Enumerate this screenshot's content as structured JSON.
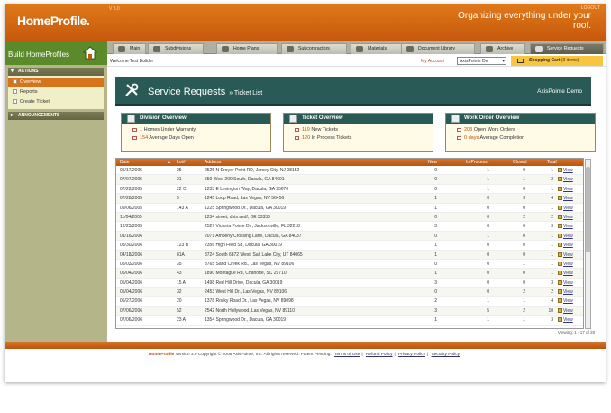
{
  "app": {
    "logo": "HomeProfile.",
    "version": "V 3.0",
    "tagline": "Organizing everything under your roof.",
    "logout": "LOGOUT"
  },
  "sidebar": {
    "title": "Build HomeProfiles",
    "actions": "ACTIONS",
    "items": [
      {
        "label": "Overview"
      },
      {
        "label": "Reports"
      },
      {
        "label": "Create Ticket"
      }
    ],
    "announcements": "ANNOUNCEMENTS"
  },
  "tabs": [
    {
      "label": "Main"
    },
    {
      "label": "Subdivisions"
    },
    {
      "label": "Home Plans"
    },
    {
      "label": "Subcontractors"
    },
    {
      "label": "Materials"
    },
    {
      "label": "Document Library"
    },
    {
      "label": "Archive"
    },
    {
      "label": "Service Requests"
    }
  ],
  "userbar": {
    "welcome": "Welcome Test Builder",
    "my_account": "My Account",
    "account_select": "AxisPointe De",
    "cart": "Shopping Cart",
    "cart_count": "(3 items)"
  },
  "banner": {
    "title": "Service Requests",
    "sub": "» Ticket List",
    "company": "AxisPointe Demo"
  },
  "division": {
    "title": "Division Overview",
    "l1n": "1",
    "l1": "Homes Under Warranty",
    "l2n": "154",
    "l2": "Average Days Open"
  },
  "ticket": {
    "title": "Ticket Overview",
    "l1n": "119",
    "l1": "New Tickets",
    "l2n": "120",
    "l2": "In Process Tickets"
  },
  "workorder": {
    "title": "Work Order Overview",
    "l1n": "203",
    "l1": "Open Work Orders",
    "l2n": "0 days",
    "l2": "Average Completion"
  },
  "table": {
    "headers": [
      "Date",
      "▲",
      "Lot#",
      "Address",
      "New",
      "In Process",
      "Closed",
      "Total"
    ],
    "view_label": "View",
    "rows": [
      [
        "05/17/2005",
        "25",
        "2525 N Droyer Point RD, Jersey City, NJ 08152",
        "0",
        "1",
        "0",
        "1"
      ],
      [
        "07/07/2005",
        "21",
        "550 West 200 South, Dacula, GA 84601",
        "0",
        "1",
        "1",
        "2"
      ],
      [
        "07/22/2005",
        "22 C",
        "1233 E Lexington Way, Dacula, GA 95670",
        "0",
        "1",
        "0",
        "1"
      ],
      [
        "07/28/2005",
        "5",
        "1245 Loop Road, Las Vegas, NV 56456",
        "1",
        "0",
        "3",
        "4"
      ],
      [
        "09/06/2005",
        "143 A",
        "1225 Springwood Dr., Dacula, GA 30019",
        "1",
        "0",
        "0",
        "1"
      ],
      [
        "11/04/2005",
        "",
        "1234 street, dsts asdf, DE 33333",
        "0",
        "0",
        "2",
        "2"
      ],
      [
        "12/23/2005",
        "",
        "2527 Victoria Pointe Dr., Jacksonville, FL 32218",
        "3",
        "0",
        "0",
        "3"
      ],
      [
        "01/16/2006",
        "",
        "2071 Amberly Crossing Lane, Dacula, GA 84037",
        "0",
        "1",
        "0",
        "1"
      ],
      [
        "03/30/2006",
        "123 B",
        "2356 High Field St., Dacula, GA 30019",
        "1",
        "0",
        "0",
        "1"
      ],
      [
        "04/18/2006",
        "81A",
        "8724 South 6872 West, Salt Lake City, UT 84065",
        "1",
        "0",
        "0",
        "1"
      ],
      [
        "05/03/2006",
        "35",
        "3765 Sand Creek Rd., Las Vegas, NV 89106",
        "0",
        "0",
        "1",
        "1"
      ],
      [
        "05/04/2006",
        "43",
        "1890 Montague Rd, Charlotte, SC 29710",
        "1",
        "0",
        "0",
        "1"
      ],
      [
        "05/04/2006",
        "15 A",
        "1498 Red Hill Drive, Dacula, GA 30019",
        "3",
        "0",
        "0",
        "3"
      ],
      [
        "05/04/2006",
        "32",
        "2453 West Hill Dr., Las Vegas, NV 89106",
        "0",
        "0",
        "2",
        "2"
      ],
      [
        "06/27/2006",
        "20",
        "1378 Rocky Road Dr., Las Vegas, NV 89098",
        "2",
        "1",
        "1",
        "4"
      ],
      [
        "07/06/2006",
        "52",
        "2542 North Hollywood, Las Vegas, NV 89110",
        "3",
        "5",
        "2",
        "10"
      ],
      [
        "07/06/2006",
        "23 A",
        "1354 Springwood Dr., Dacula, GA 30019",
        "1",
        "1",
        "1",
        "3"
      ]
    ]
  },
  "viewing": "Viewing: 1 - 17 of 28",
  "footer": {
    "hp": "HomeProfile",
    "rest": "Version 3.0 Copyright © 2008 AxisPointe, Inc. All rights reserved. Patent Pending.",
    "terms": "Terms of Use",
    "refund": "Refund Policy",
    "privacy": "Privacy Policy",
    "security": "Security Policy"
  }
}
